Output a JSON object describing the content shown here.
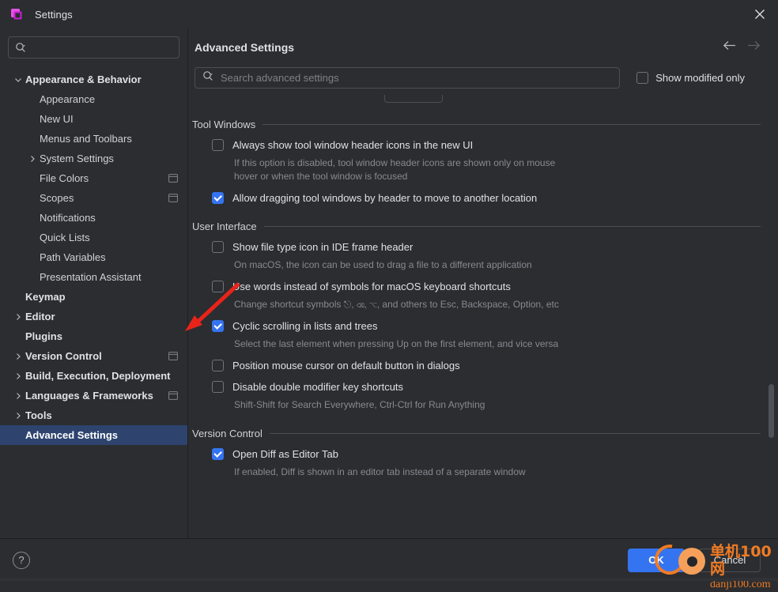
{
  "window": {
    "title": "Settings",
    "app_icon": "ide-settings-icon",
    "close_icon": "close-icon"
  },
  "sidebar": {
    "search": {
      "placeholder": "",
      "value": "",
      "icon": "search-icon"
    },
    "items": [
      {
        "label": "Appearance & Behavior",
        "level": 0,
        "chevron": "down",
        "selected": false,
        "trailing": ""
      },
      {
        "label": "Appearance",
        "level": 1,
        "chevron": "",
        "selected": false,
        "trailing": ""
      },
      {
        "label": "New UI",
        "level": 1,
        "chevron": "",
        "selected": false,
        "trailing": ""
      },
      {
        "label": "Menus and Toolbars",
        "level": 1,
        "chevron": "",
        "selected": false,
        "trailing": ""
      },
      {
        "label": "System Settings",
        "level": 1,
        "chevron": "right",
        "selected": false,
        "trailing": ""
      },
      {
        "label": "File Colors",
        "level": 1,
        "chevron": "",
        "selected": false,
        "trailing": "project-scope-icon"
      },
      {
        "label": "Scopes",
        "level": 1,
        "chevron": "",
        "selected": false,
        "trailing": "project-scope-icon"
      },
      {
        "label": "Notifications",
        "level": 1,
        "chevron": "",
        "selected": false,
        "trailing": ""
      },
      {
        "label": "Quick Lists",
        "level": 1,
        "chevron": "",
        "selected": false,
        "trailing": ""
      },
      {
        "label": "Path Variables",
        "level": 1,
        "chevron": "",
        "selected": false,
        "trailing": ""
      },
      {
        "label": "Presentation Assistant",
        "level": 1,
        "chevron": "",
        "selected": false,
        "trailing": ""
      },
      {
        "label": "Keymap",
        "level": 0,
        "chevron": "",
        "selected": false,
        "trailing": ""
      },
      {
        "label": "Editor",
        "level": 0,
        "chevron": "right",
        "selected": false,
        "trailing": ""
      },
      {
        "label": "Plugins",
        "level": 0,
        "chevron": "",
        "selected": false,
        "trailing": ""
      },
      {
        "label": "Version Control",
        "level": 0,
        "chevron": "right",
        "selected": false,
        "trailing": "project-scope-icon"
      },
      {
        "label": "Build, Execution, Deployment",
        "level": 0,
        "chevron": "right",
        "selected": false,
        "trailing": ""
      },
      {
        "label": "Languages & Frameworks",
        "level": 0,
        "chevron": "right",
        "selected": false,
        "trailing": "project-scope-icon"
      },
      {
        "label": "Tools",
        "level": 0,
        "chevron": "right",
        "selected": false,
        "trailing": ""
      },
      {
        "label": "Advanced Settings",
        "level": 0,
        "chevron": "",
        "selected": true,
        "trailing": ""
      }
    ]
  },
  "content": {
    "title": "Advanced Settings",
    "nav": {
      "back_icon": "arrow-left-icon",
      "forward_icon": "arrow-right-icon"
    },
    "search": {
      "placeholder": "Search advanced settings",
      "value": "",
      "icon": "search-icon"
    },
    "show_modified_only": {
      "label": "Show modified only",
      "checked": false
    },
    "groups": [
      {
        "title": "Tool Windows",
        "options": [
          {
            "label": "Always show tool window header icons in the new UI",
            "checked": false,
            "description": "If this option is disabled, tool window header icons are shown only on mouse hover or when the tool window is focused"
          },
          {
            "label": "Allow dragging tool windows by header to move to another location",
            "checked": true,
            "description": ""
          }
        ]
      },
      {
        "title": "User Interface",
        "options": [
          {
            "label": "Show file type icon in IDE frame header",
            "checked": false,
            "description": "On macOS, the icon can be used to drag a file to a different application"
          },
          {
            "label": "Use words instead of symbols for macOS keyboard shortcuts",
            "checked": false,
            "description": "Change shortcut symbols ⎋, ⌫, ⌥, and others to Esc, Backspace, Option, etc"
          },
          {
            "label": "Cyclic scrolling in lists and trees",
            "checked": true,
            "description": "Select the last element when pressing Up on the first element, and vice versa"
          },
          {
            "label": "Position mouse cursor on default button in dialogs",
            "checked": false,
            "description": ""
          },
          {
            "label": "Disable double modifier key shortcuts",
            "checked": false,
            "description": "Shift-Shift for Search Everywhere, Ctrl-Ctrl for Run Anything"
          }
        ]
      },
      {
        "title": "Version Control",
        "options": [
          {
            "label": "Open Diff as Editor Tab",
            "checked": true,
            "description": "If enabled, Diff is shown in an editor tab instead of a separate window"
          }
        ]
      }
    ]
  },
  "footer": {
    "help_label": "?",
    "ok_label": "OK",
    "cancel_label": "Cancel"
  },
  "watermark": {
    "cn": "单机100网",
    "en": "danji100.com"
  },
  "colors": {
    "accent": "#3574f0",
    "selection": "#2e436e",
    "background": "#2b2d30",
    "watermark": "#f07b23",
    "annotation_arrow": "#e8241a"
  }
}
